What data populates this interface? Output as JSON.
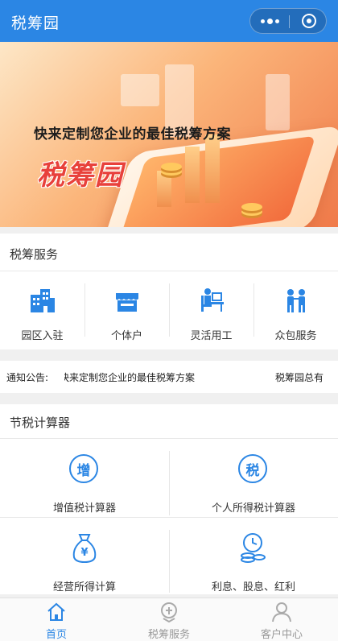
{
  "app": {
    "title": "税筹园"
  },
  "banner": {
    "headline": "快来定制您企业的最佳税筹方案",
    "logo": "税筹园"
  },
  "services": {
    "title": "税筹服务",
    "items": [
      {
        "label": "园区入驻",
        "icon": "building-icon"
      },
      {
        "label": "个体户",
        "icon": "storefront-icon"
      },
      {
        "label": "灵活用工",
        "icon": "desk-worker-icon"
      },
      {
        "label": "众包服务",
        "icon": "people-icon"
      }
    ]
  },
  "notice": {
    "label": "通知公告:",
    "message": "快来定制您企业的最佳税筹方案",
    "message_next": "税筹园总有"
  },
  "calculator": {
    "title": "节税计算器",
    "items": [
      {
        "label": "增值税计算器",
        "glyph": "增",
        "icon": "vat-icon"
      },
      {
        "label": "个人所得税计算器",
        "glyph": "税",
        "icon": "income-tax-icon"
      },
      {
        "label": "经营所得计算",
        "glyph": "¥",
        "icon": "money-bag-icon"
      },
      {
        "label": "利息、股息、红利",
        "glyph": "",
        "icon": "coins-clock-icon"
      }
    ]
  },
  "tabbar": {
    "items": [
      {
        "label": "首页",
        "icon": "home-icon",
        "active": true
      },
      {
        "label": "税筹服务",
        "icon": "tax-service-icon"
      },
      {
        "label": "客户中心",
        "icon": "user-icon"
      }
    ]
  },
  "colors": {
    "primary": "#2b86e4",
    "banner_accent": "#f07a4a",
    "logo_red": "#e8413b"
  }
}
